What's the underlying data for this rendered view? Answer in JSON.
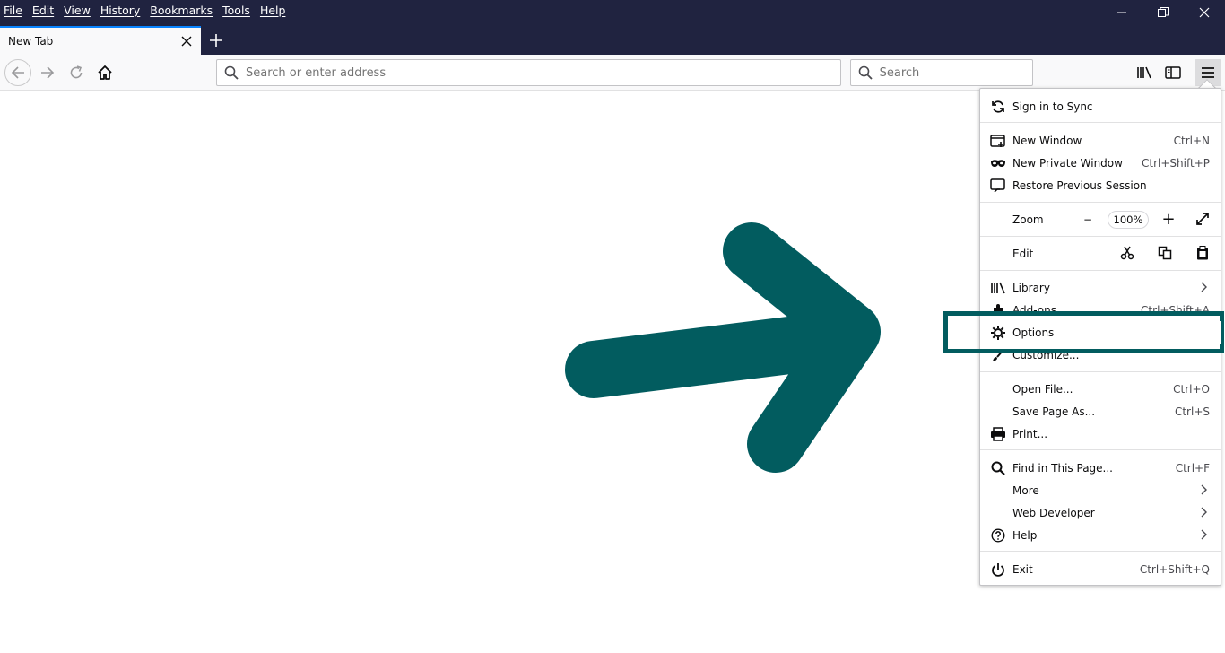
{
  "menubar": [
    "File",
    "Edit",
    "View",
    "History",
    "Bookmarks",
    "Tools",
    "Help"
  ],
  "tab": {
    "title": "New Tab"
  },
  "urlbar": {
    "placeholder": "Search or enter address"
  },
  "searchbar": {
    "placeholder": "Search"
  },
  "annotation": {
    "color": "#025c5f"
  },
  "menu": {
    "sync": "Sign in to Sync",
    "new_window": {
      "label": "New Window",
      "shortcut": "Ctrl+N"
    },
    "new_private": {
      "label": "New Private Window",
      "shortcut": "Ctrl+Shift+P"
    },
    "restore": {
      "label": "Restore Previous Session"
    },
    "zoom": {
      "label": "Zoom",
      "minus": "−",
      "value": "100%",
      "plus": "+"
    },
    "edit": {
      "label": "Edit"
    },
    "library": {
      "label": "Library"
    },
    "addons": {
      "label": "Add-ons",
      "shortcut": "Ctrl+Shift+A"
    },
    "options": {
      "label": "Options"
    },
    "customize": {
      "label": "Customize..."
    },
    "open_file": {
      "label": "Open File...",
      "shortcut": "Ctrl+O"
    },
    "save_page": {
      "label": "Save Page As...",
      "shortcut": "Ctrl+S"
    },
    "print": {
      "label": "Print..."
    },
    "find": {
      "label": "Find in This Page...",
      "shortcut": "Ctrl+F"
    },
    "more": {
      "label": "More"
    },
    "web_dev": {
      "label": "Web Developer"
    },
    "help": {
      "label": "Help"
    },
    "exit": {
      "label": "Exit",
      "shortcut": "Ctrl+Shift+Q"
    }
  }
}
